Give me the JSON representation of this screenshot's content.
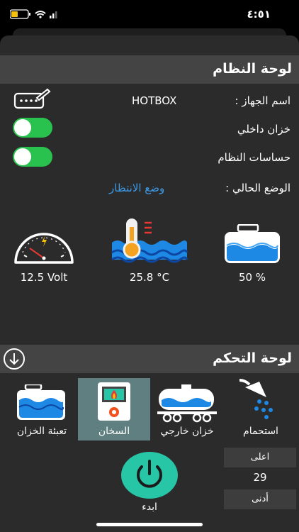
{
  "status": {
    "time": "٤:٥١"
  },
  "system_panel": {
    "title": "لوحة النظام",
    "device_name_label": "اسم الجهاز :",
    "device_name_value": "HOTBOX",
    "internal_tank_label": "خزان داخلي",
    "system_sensors_label": "حساسات النظام",
    "current_mode_label": "الوضع الحالي :",
    "current_mode_value": "وضع الانتظار",
    "voltage": "12.5 Volt",
    "temperature": "25.8 °C",
    "tank_level": "50 %"
  },
  "control_panel": {
    "title": "لوحة التحكم",
    "tiles": [
      {
        "label": "استحمام"
      },
      {
        "label": "خزان خارجي"
      },
      {
        "label": "السخان"
      },
      {
        "label": "تعبئة الخزان"
      }
    ],
    "upper_label": "اعلى",
    "level_value": "29",
    "lower_label": "أدنى",
    "start_label": "ابدء"
  },
  "colors": {
    "toggle_on": "#29c24e",
    "accent_blue": "#3d9ae6",
    "power_teal": "#26c6a7",
    "selected_tile": "#5f7f80"
  }
}
